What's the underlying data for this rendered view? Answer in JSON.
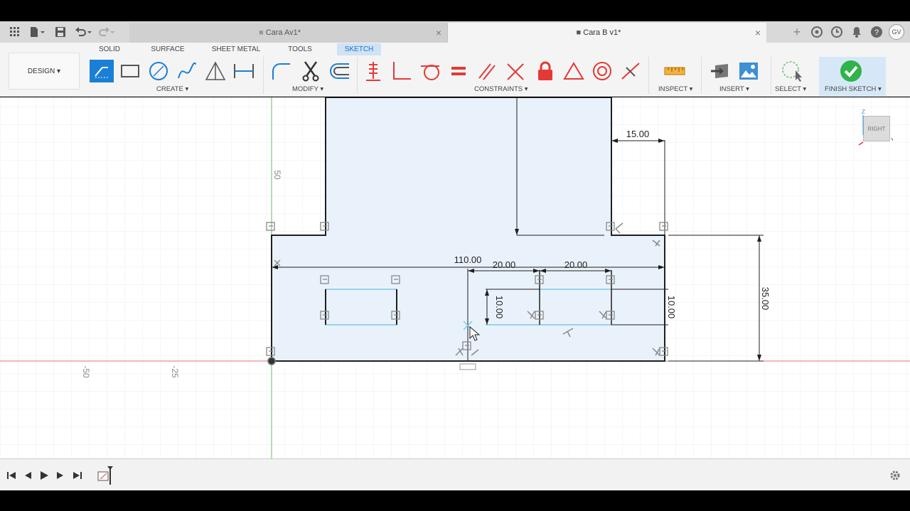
{
  "tabs": [
    {
      "label": "Cara Av1*"
    },
    {
      "label": "Cara B v1*"
    }
  ],
  "user_initials": "GV",
  "toolbar": {
    "design_label": "DESIGN ▾",
    "workspaces": [
      "SOLID",
      "SURFACE",
      "SHEET METAL",
      "TOOLS",
      "SKETCH"
    ],
    "groups": {
      "create": "CREATE ▾",
      "modify": "MODIFY ▾",
      "constraints": "CONSTRAINTS ▾",
      "inspect": "INSPECT ▾",
      "insert": "INSERT ▾",
      "select": "SELECT ▾",
      "finish": "FINISH SKETCH ▾"
    }
  },
  "colors": {
    "accent": "#1a7fd6",
    "sketch_fill": "#e9f2fb",
    "dimension_line": "#222222",
    "x_axis": "#e57373",
    "y_axis": "#66bb6a",
    "constraint_red": "#e53935",
    "finish_green": "#2fb34a"
  },
  "viewcube_label": "RIGHT",
  "canvas": {
    "ruler_labels": {
      "x_left": "-50",
      "x_mid": "-25",
      "y_up": "50"
    },
    "dimensions": {
      "d_110": "110.00",
      "d_20a": "20.00",
      "d_20b": "20.00",
      "d_15": "15.00",
      "d_10a": "10.00",
      "d_10b": "10.00",
      "d_35": "35.00"
    }
  }
}
